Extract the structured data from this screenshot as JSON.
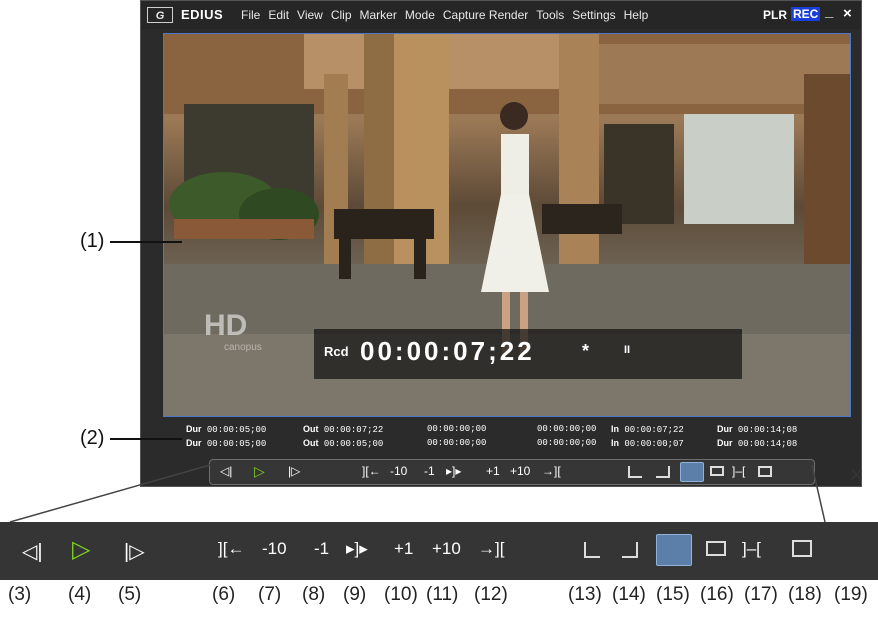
{
  "titlebar": {
    "logo": "G",
    "app_name": "EDIUS",
    "menu": [
      "File",
      "Edit",
      "View",
      "Clip",
      "Marker",
      "Mode",
      "Capture Render",
      "Tools",
      "Settings",
      "Help"
    ],
    "plr": "PLR",
    "rec": "REC",
    "minimize": "_",
    "close": "×"
  },
  "video": {
    "watermark_hd": "HD",
    "watermark_sub": "canopus",
    "rcd_label": "Rcd",
    "timecode": "00:00:07;22",
    "timecode_suffix": "*",
    "pause_glyph": "II"
  },
  "status": {
    "row1": {
      "dur_label": "Dur",
      "dur": "00:00:05;00",
      "out_label": "Out",
      "out": "00:00:07;22",
      "a": "00:00:00;00",
      "b": "00:00:00;00",
      "in_label": "In",
      "in": "00:00:07;22",
      "dur2_label": "Dur",
      "dur2": "00:00:14;08"
    },
    "row2": {
      "dur_label": "Dur",
      "dur": "00:00:05;00",
      "out_label": "Out",
      "out": "00:00:05;00",
      "a": "00:00:00;00",
      "b": "00:00:00;00",
      "in_label": "In",
      "in": "00:00:00;07",
      "dur2_label": "Dur",
      "dur2": "00:00:14;08"
    }
  },
  "toolbar": {
    "minus10": "-10",
    "minus1": "-1",
    "plus1": "+1",
    "plus10": "+10",
    "close": "×"
  },
  "callouts": {
    "c1": "(1)",
    "c2": "(2)",
    "labels": [
      "(3)",
      "(4)",
      "(5)",
      "(6)",
      "(7)",
      "(8)",
      "(9)",
      "(10)",
      "(11)",
      "(12)",
      "(13)",
      "(14)",
      "(15)",
      "(16)",
      "(17)",
      "(18)",
      "(19)"
    ]
  },
  "colors": {
    "play_green": "#7ed321",
    "rec_blue": "#1a3fd8",
    "selected_blue": "#5b7fa8"
  }
}
